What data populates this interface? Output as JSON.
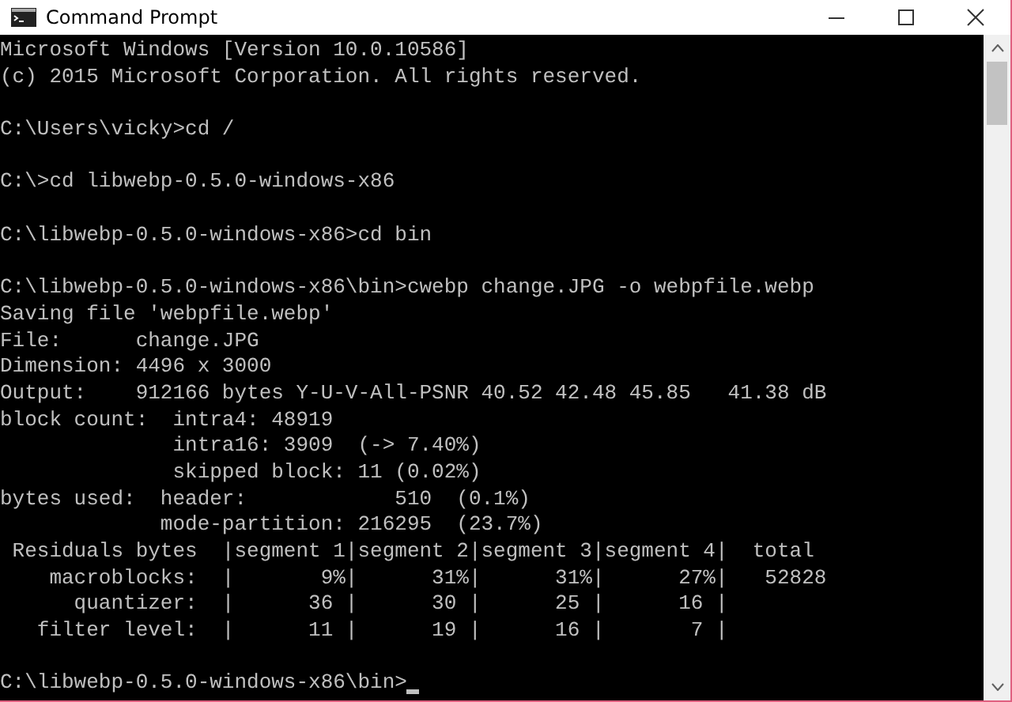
{
  "window": {
    "title": "Command Prompt"
  },
  "console": {
    "blocks": [
      [
        "Microsoft Windows [Version 10.0.10586]",
        "(c) 2015 Microsoft Corporation. All rights reserved."
      ],
      [
        "C:\\Users\\vicky>cd /"
      ],
      [
        "C:\\>cd libwebp-0.5.0-windows-x86"
      ],
      [
        "C:\\libwebp-0.5.0-windows-x86>cd bin"
      ],
      [
        "C:\\libwebp-0.5.0-windows-x86\\bin>cwebp change.JPG -o webpfile.webp",
        "Saving file 'webpfile.webp'",
        "File:      change.JPG",
        "Dimension: 4496 x 3000",
        "Output:    912166 bytes Y-U-V-All-PSNR 40.52 42.48 45.85   41.38 dB",
        "block count:  intra4: 48919",
        "              intra16: 3909  (-> 7.40%)",
        "              skipped block: 11 (0.02%)",
        "bytes used:  header:            510  (0.1%)",
        "             mode-partition: 216295  (23.7%)",
        " Residuals bytes  |segment 1|segment 2|segment 3|segment 4|  total",
        "    macroblocks:  |       9%|      31%|      31%|      27%|   52828",
        "      quantizer:  |      36 |      30 |      25 |      16 |",
        "   filter level:  |      11 |      19 |      16 |       7 |"
      ]
    ],
    "prompt": "C:\\libwebp-0.5.0-windows-x86\\bin>"
  }
}
